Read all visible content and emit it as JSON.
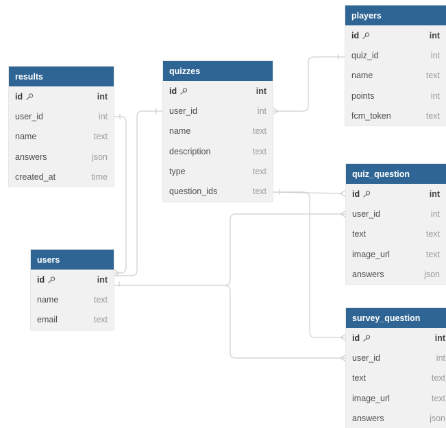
{
  "tables": {
    "results": {
      "name": "results",
      "fields": [
        {
          "name": "id",
          "type": "int"
        },
        {
          "name": "user_id",
          "type": "int"
        },
        {
          "name": "name",
          "type": "text"
        },
        {
          "name": "answers",
          "type": "json"
        },
        {
          "name": "created_at",
          "type": "time"
        }
      ]
    },
    "quizzes": {
      "name": "quizzes",
      "fields": [
        {
          "name": "id",
          "type": "int"
        },
        {
          "name": "user_id",
          "type": "int"
        },
        {
          "name": "name",
          "type": "text"
        },
        {
          "name": "description",
          "type": "text"
        },
        {
          "name": "type",
          "type": "text"
        },
        {
          "name": "question_ids",
          "type": "text"
        }
      ]
    },
    "players": {
      "name": "players",
      "fields": [
        {
          "name": "id",
          "type": "int"
        },
        {
          "name": "quiz_id",
          "type": "int"
        },
        {
          "name": "name",
          "type": "text"
        },
        {
          "name": "points",
          "type": "int"
        },
        {
          "name": "fcm_token",
          "type": "text"
        }
      ]
    },
    "users": {
      "name": "users",
      "fields": [
        {
          "name": "id",
          "type": "int"
        },
        {
          "name": "name",
          "type": "text"
        },
        {
          "name": "email",
          "type": "text"
        }
      ]
    },
    "quiz_question": {
      "name": "quiz_question",
      "fields": [
        {
          "name": "id",
          "type": "int"
        },
        {
          "name": "user_id",
          "type": "int"
        },
        {
          "name": "text",
          "type": "text"
        },
        {
          "name": "image_url",
          "type": "text"
        },
        {
          "name": "answers",
          "type": "json"
        }
      ]
    },
    "survey_question": {
      "name": "survey_question",
      "fields": [
        {
          "name": "id",
          "type": "int"
        },
        {
          "name": "user_id",
          "type": "int"
        },
        {
          "name": "text",
          "type": "text"
        },
        {
          "name": "image_url",
          "type": "text"
        },
        {
          "name": "answers",
          "type": "json"
        }
      ]
    }
  },
  "colors": {
    "header": "#2f6594",
    "body": "#f1f1f1",
    "connector": "#c8c8c8"
  }
}
